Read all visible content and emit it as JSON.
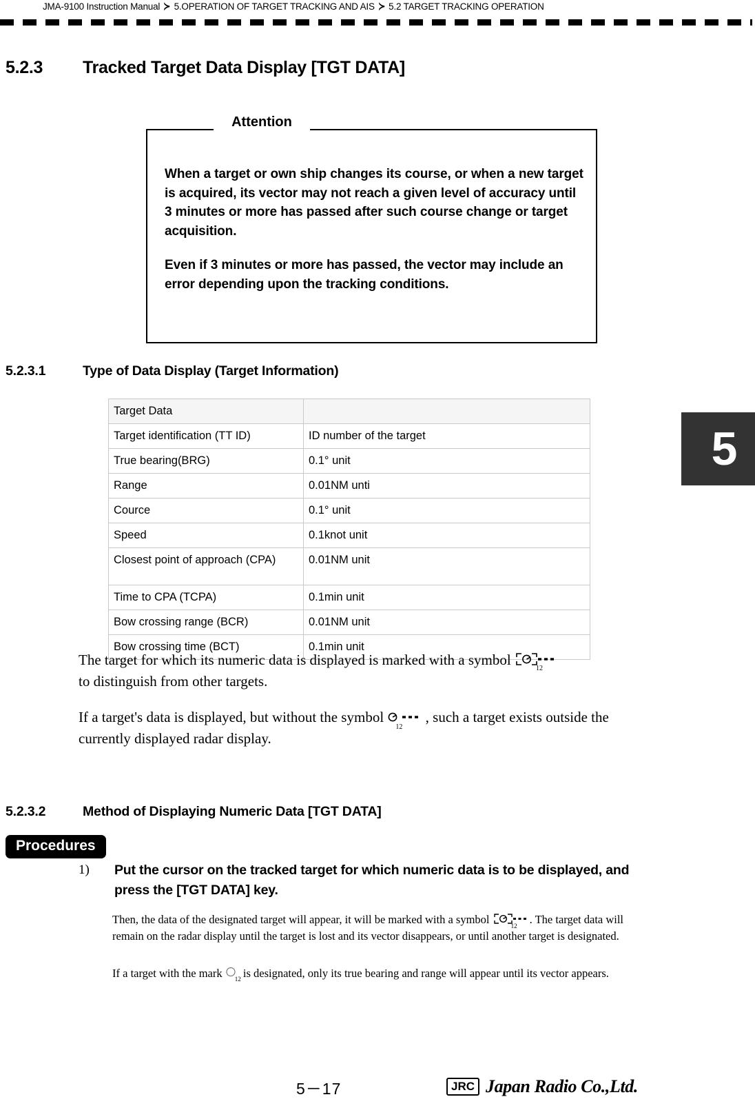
{
  "header": {
    "breadcrumb": [
      "JMA-9100 Instruction Manual",
      "5.OPERATION OF TARGET TRACKING AND AIS",
      "5.2  TARGET TRACKING OPERATION"
    ],
    "separator": "≻"
  },
  "chapter_tab": {
    "label": "5",
    "background": "#333333",
    "color": "#ffffff"
  },
  "section": {
    "number": "5.2.3",
    "title": "Tracked Target Data Display [TGT DATA]"
  },
  "attention": {
    "title": "Attention",
    "paragraphs": [
      "When a target or own ship changes its course, or when a new target is acquired, its vector may not reach a given level of accuracy until 3 minutes or more has passed after such course change or target acquisition.",
      "Even if 3 minutes or more has passed, the vector may include an error depending upon the tracking conditions."
    ]
  },
  "subsection_1": {
    "number": "5.2.3.1",
    "title": "Type of Data Display (Target Information)"
  },
  "table": {
    "rows": [
      {
        "label": "Target Data",
        "value": ""
      },
      {
        "label": "Target identification (TT ID)",
        "value": "ID number of the target"
      },
      {
        "label": "True bearing(BRG)",
        "value": "0.1° unit"
      },
      {
        "label": "Range",
        "value": "0.01NM unti"
      },
      {
        "label": "Cource",
        "value": "0.1° unit"
      },
      {
        "label": "Speed",
        "value": "0.1knot unit"
      },
      {
        "label": "Closest point of approach (CPA)",
        "value": "0.01NM unit"
      },
      {
        "label": "Time to CPA (TCPA)",
        "value": "0.1min unit"
      },
      {
        "label": "Bow crossing range (BCR)",
        "value": "0.01NM unit"
      },
      {
        "label": "Bow crossing time (BCT)",
        "value": "0.1min unit"
      }
    ]
  },
  "body": {
    "p1_before": "The target for which its numeric data is displayed is marked with a symbol ",
    "p1_after": "to distinguish from other targets.",
    "p2_before": "If a target's data is displayed, but without the symbol ",
    "p2_after": " , such a target exists outside the currently displayed radar display."
  },
  "subsection_2": {
    "number": "5.2.3.2",
    "title": "Method of Displaying Numeric Data [TGT DATA]"
  },
  "procedures": {
    "badge": "Procedures",
    "step_number": "1)",
    "step_text": "Put the cursor on the tracked target for which numeric data is to be displayed, and press the [TGT DATA] key.",
    "note1_before": "Then, the data of the designated target will appear, it will be marked with a symbol ",
    "note1_after": ". The target data will remain on the radar display until the target is lost and its vector disappears, or until another target is designated.",
    "note2_before": "If a target with the mark ",
    "note2_after": " is designated, only its true bearing and range will appear until its vector appears."
  },
  "symbols": {
    "tracked_subscript": "12"
  },
  "footer": {
    "page": "5－17",
    "logo_mark": "JRC",
    "company": "Japan Radio Co.,Ltd."
  }
}
